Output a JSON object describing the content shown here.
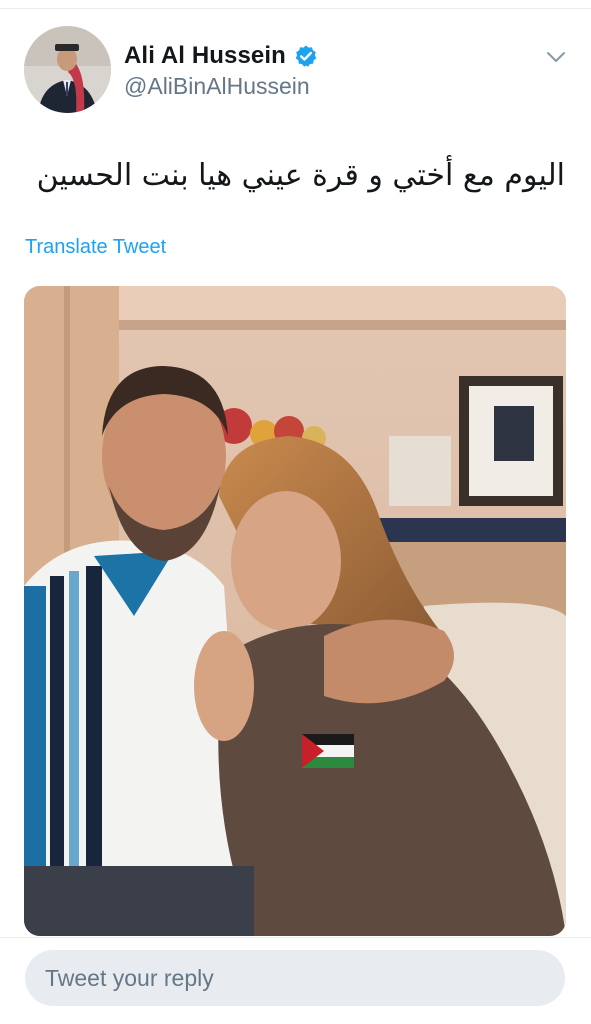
{
  "tweet": {
    "author": {
      "display_name": "Ali Al Hussein",
      "handle": "@AliBinAlHussein",
      "verified": true,
      "avatar_icon": "profile-photo-icon"
    },
    "menu_icon": "chevron-down-icon",
    "text": "اليوم مع أختي و قرة عيني هيا بنت الحسين",
    "translate_label": "Translate Tweet",
    "media_alt": "photo"
  },
  "reply": {
    "placeholder": "Tweet your reply"
  },
  "colors": {
    "accent": "#1da1f2",
    "text_primary": "#14171a",
    "text_secondary": "#657786",
    "divider": "#e6ecf0",
    "reply_bg": "#e8ecf0"
  }
}
